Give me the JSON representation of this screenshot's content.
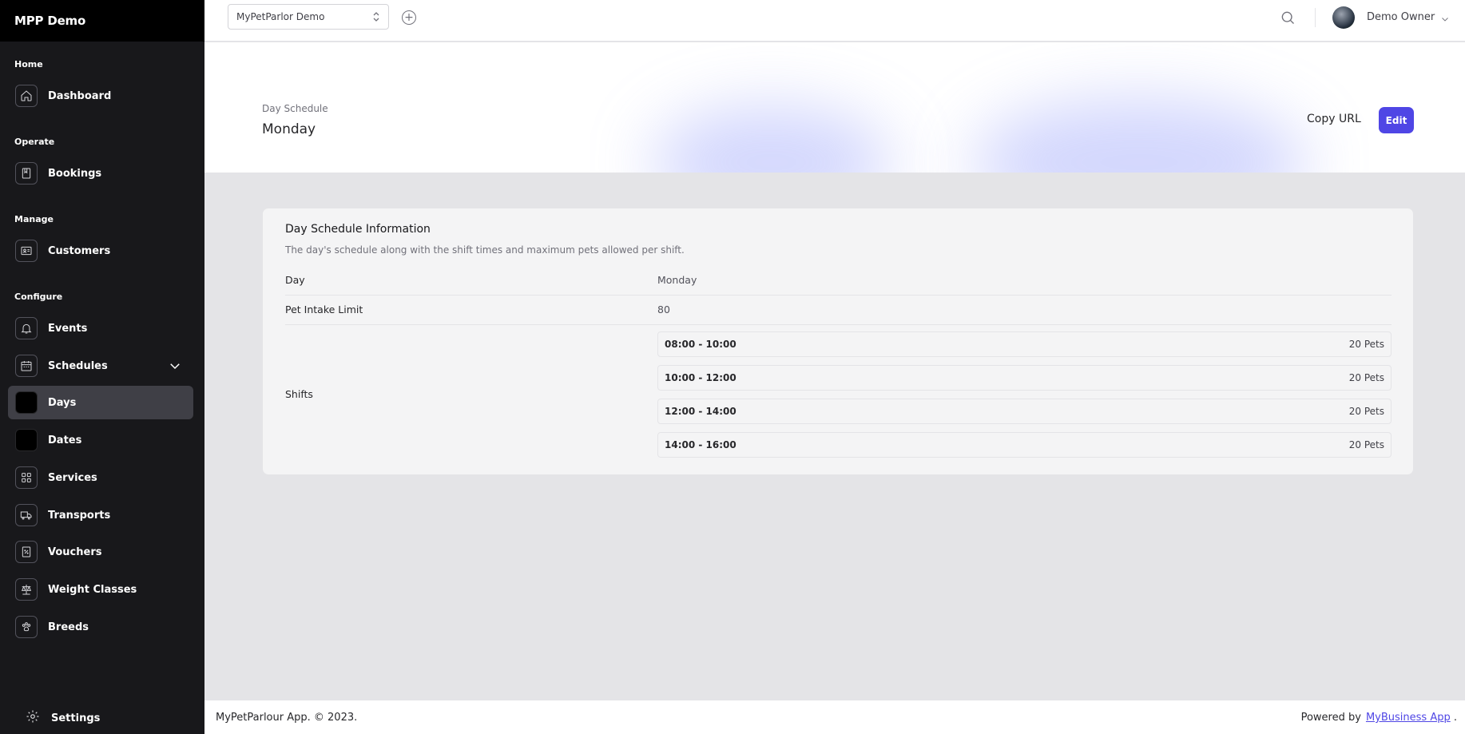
{
  "app": {
    "brand": "MPP Demo"
  },
  "sidebar": {
    "sections": [
      {
        "label": "Home"
      },
      {
        "label": "Operate"
      },
      {
        "label": "Manage"
      },
      {
        "label": "Configure"
      }
    ],
    "items": [
      {
        "label": "Dashboard",
        "icon": "home-icon"
      },
      {
        "label": "Bookings",
        "icon": "book-icon"
      },
      {
        "label": "Customers",
        "icon": "id-card-icon"
      },
      {
        "label": "Events",
        "icon": "bell-icon"
      },
      {
        "label": "Schedules",
        "icon": "calendar-icon"
      },
      {
        "label": "Days",
        "icon": "square-icon"
      },
      {
        "label": "Dates",
        "icon": "square-icon"
      },
      {
        "label": "Services",
        "icon": "grid-icon"
      },
      {
        "label": "Transports",
        "icon": "truck-icon"
      },
      {
        "label": "Vouchers",
        "icon": "discount-icon"
      },
      {
        "label": "Weight Classes",
        "icon": "scale-icon"
      },
      {
        "label": "Breeds",
        "icon": "paw-icon"
      }
    ],
    "settings_label": "Settings",
    "active_item": "Days"
  },
  "topbar": {
    "tenant": "MyPetParlor Demo",
    "user_name": "Demo Owner"
  },
  "header": {
    "breadcrumb": "Day Schedule",
    "title": "Monday",
    "copy_url_label": "Copy URL",
    "edit_label": "Edit"
  },
  "card": {
    "title": "Day Schedule Information",
    "subtitle": "The day's schedule along with the shift times and maximum pets allowed per shift.",
    "day_label": "Day",
    "day_value": "Monday",
    "limit_label": "Pet Intake Limit",
    "limit_value": "80",
    "shifts_label": "Shifts",
    "shifts": [
      {
        "time": "08:00 - 10:00",
        "pets": "20 Pets"
      },
      {
        "time": "10:00 - 12:00",
        "pets": "20 Pets"
      },
      {
        "time": "12:00 - 14:00",
        "pets": "20 Pets"
      },
      {
        "time": "14:00 - 16:00",
        "pets": "20 Pets"
      }
    ]
  },
  "footer": {
    "left": "MyPetParlour App. © 2023.",
    "powered_by": "Powered by",
    "link": "MyBusiness App",
    "trail": "."
  },
  "colors": {
    "accent": "#4f46e5",
    "sidebar": "#18181b",
    "active": "#3f3f46"
  }
}
